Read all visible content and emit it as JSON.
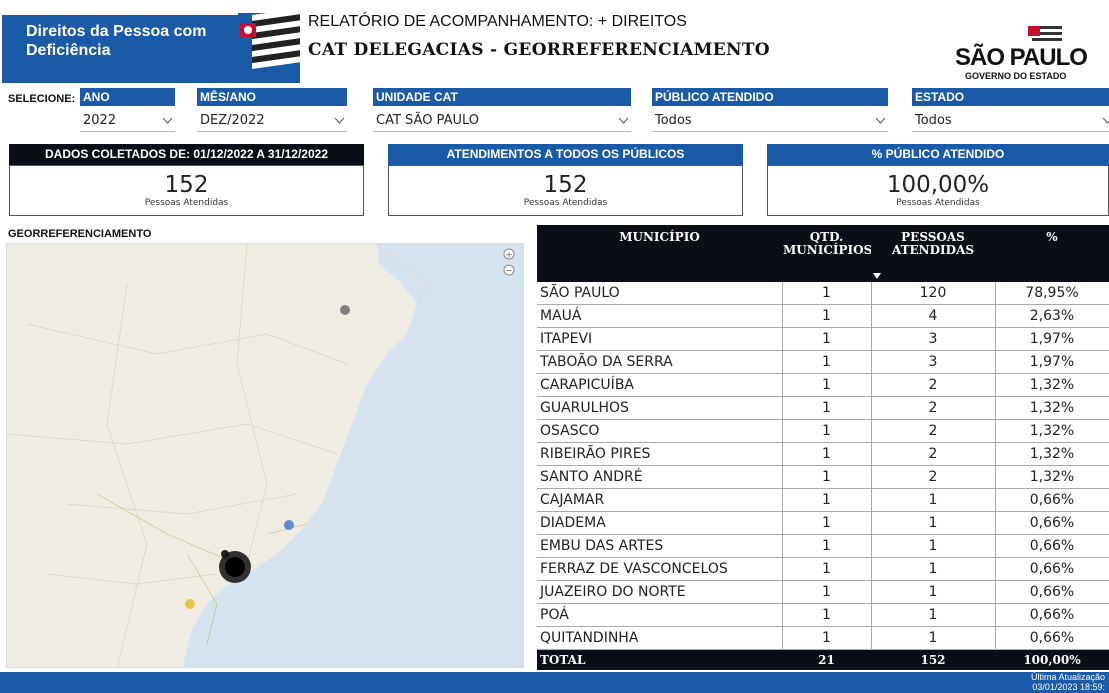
{
  "header": {
    "brand_title": "Direitos da Pessoa com Deficiência",
    "report_line1": "RELATÓRIO DE ACOMPANHAMENTO: + DIREITOS",
    "report_line2": "CAT DELEGACIAS - GEORREFERENCIAMENTO",
    "gov_logo_name": "SÃO PAULO",
    "gov_logo_sub": "GOVERNO DO ESTADO"
  },
  "filters": {
    "selecione_label": "SELECIONE:",
    "ano": {
      "label": "ANO",
      "value": "2022"
    },
    "mes_ano": {
      "label": "MÊS/ANO",
      "value": "DEZ/2022"
    },
    "unidade_cat": {
      "label": "UNIDADE CAT",
      "value": "CAT SÃO PAULO"
    },
    "publico": {
      "label": "PÚBLICO ATENDIDO",
      "value": "Todos"
    },
    "estado": {
      "label": "ESTADO",
      "value": "Todos"
    }
  },
  "kpis": {
    "periodo": {
      "header": "DADOS COLETADOS DE: 01/12/2022 A 31/12/2022",
      "value": "152",
      "sub": "Pessoas Atendidas"
    },
    "todos": {
      "header": "ATENDIMENTOS A TODOS OS PÚBLICOS",
      "value": "152",
      "sub": "Pessoas Atendidas"
    },
    "percent": {
      "header": "% PÚBLICO ATENDIDO",
      "value": "100,00%",
      "sub": "Pessoas Atendidas"
    }
  },
  "map": {
    "title": "GEORREFERENCIAMENTO",
    "zoom_in": "+",
    "zoom_out": "−",
    "marker_colors": [
      "#7f7f7f",
      "#5b8fd1",
      "#e8c34a",
      "#111111"
    ]
  },
  "table": {
    "columns": {
      "municipio": "MUNICÍPIO",
      "qtd_line1": "QTD.",
      "qtd_line2": "MUNICÍPIOS",
      "pessoas_line1": "PESSOAS",
      "pessoas_line2": "ATENDIDAS",
      "pct": "%"
    },
    "rows": [
      {
        "municipio": "SÃO PAULO",
        "qtd": "1",
        "pessoas": "120",
        "pct": "78,95%"
      },
      {
        "municipio": "MAUÁ",
        "qtd": "1",
        "pessoas": "4",
        "pct": "2,63%"
      },
      {
        "municipio": "ITAPEVI",
        "qtd": "1",
        "pessoas": "3",
        "pct": "1,97%"
      },
      {
        "municipio": "TABOÃO DA SERRA",
        "qtd": "1",
        "pessoas": "3",
        "pct": "1,97%"
      },
      {
        "municipio": "CARAPICUÍBA",
        "qtd": "1",
        "pessoas": "2",
        "pct": "1,32%"
      },
      {
        "municipio": "GUARULHOS",
        "qtd": "1",
        "pessoas": "2",
        "pct": "1,32%"
      },
      {
        "municipio": "OSASCO",
        "qtd": "1",
        "pessoas": "2",
        "pct": "1,32%"
      },
      {
        "municipio": "RIBEIRÃO PIRES",
        "qtd": "1",
        "pessoas": "2",
        "pct": "1,32%"
      },
      {
        "municipio": "SANTO ANDRÉ",
        "qtd": "1",
        "pessoas": "2",
        "pct": "1,32%"
      },
      {
        "municipio": "CAJAMAR",
        "qtd": "1",
        "pessoas": "1",
        "pct": "0,66%"
      },
      {
        "municipio": "DIADEMA",
        "qtd": "1",
        "pessoas": "1",
        "pct": "0,66%"
      },
      {
        "municipio": "EMBU DAS ARTES",
        "qtd": "1",
        "pessoas": "1",
        "pct": "0,66%"
      },
      {
        "municipio": "FERRAZ DE VASCONCELOS",
        "qtd": "1",
        "pessoas": "1",
        "pct": "0,66%"
      },
      {
        "municipio": "JUAZEIRO DO NORTE",
        "qtd": "1",
        "pessoas": "1",
        "pct": "0,66%"
      },
      {
        "municipio": "POÁ",
        "qtd": "1",
        "pessoas": "1",
        "pct": "0,66%"
      },
      {
        "municipio": "QUITANDINHA",
        "qtd": "1",
        "pessoas": "1",
        "pct": "0,66%"
      }
    ],
    "total": {
      "label": "TOTAL",
      "qtd": "21",
      "pessoas": "152",
      "pct": "100,00%"
    }
  },
  "footer": {
    "update_label": "Última Atualização",
    "update_value": "03/01/2023 18:59:"
  }
}
